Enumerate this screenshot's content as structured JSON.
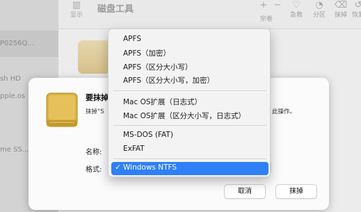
{
  "app": {
    "title": "磁盘工具"
  },
  "toolbar": {
    "view_label": "显示",
    "add_icon": "plus-icon",
    "remove_icon": "minus-icon",
    "buttons": [
      {
        "label": "宗卷",
        "icon": "volume-icon"
      },
      {
        "label": "急救",
        "icon": "first-aid-icon"
      },
      {
        "label": "分区",
        "icon": "partition-icon"
      },
      {
        "label": "抹掉",
        "icon": "erase-icon"
      },
      {
        "label": "恢复",
        "icon": "restore-icon"
      }
    ]
  },
  "sidebar": {
    "items": [
      {
        "label": "P0256Q..."
      },
      {
        "label": "sh HD"
      },
      {
        "label": "pple.os"
      },
      {
        "label": "me SS..."
      }
    ]
  },
  "dialog": {
    "title": "要抹掉",
    "desc_left": "抹掉“S",
    "desc_right": "此操作。",
    "name_label": "名称:",
    "format_label": "格式:",
    "cancel_label": "取消",
    "erase_label": "抹掉"
  },
  "format_menu": {
    "items": [
      "APFS",
      "APFS（加密）",
      "APFS（区分大小写）",
      "APFS（区分大小写，加密）",
      "Mac OS扩展（日志式）",
      "Mac OS扩展（区分大小写，日志式）",
      "MS-DOS (FAT)",
      "ExFAT"
    ],
    "selected": "Windows NTFS",
    "checkmark": "✓"
  },
  "colors": {
    "accent": "#2f80f6",
    "disk_icon": "#d8b248"
  }
}
